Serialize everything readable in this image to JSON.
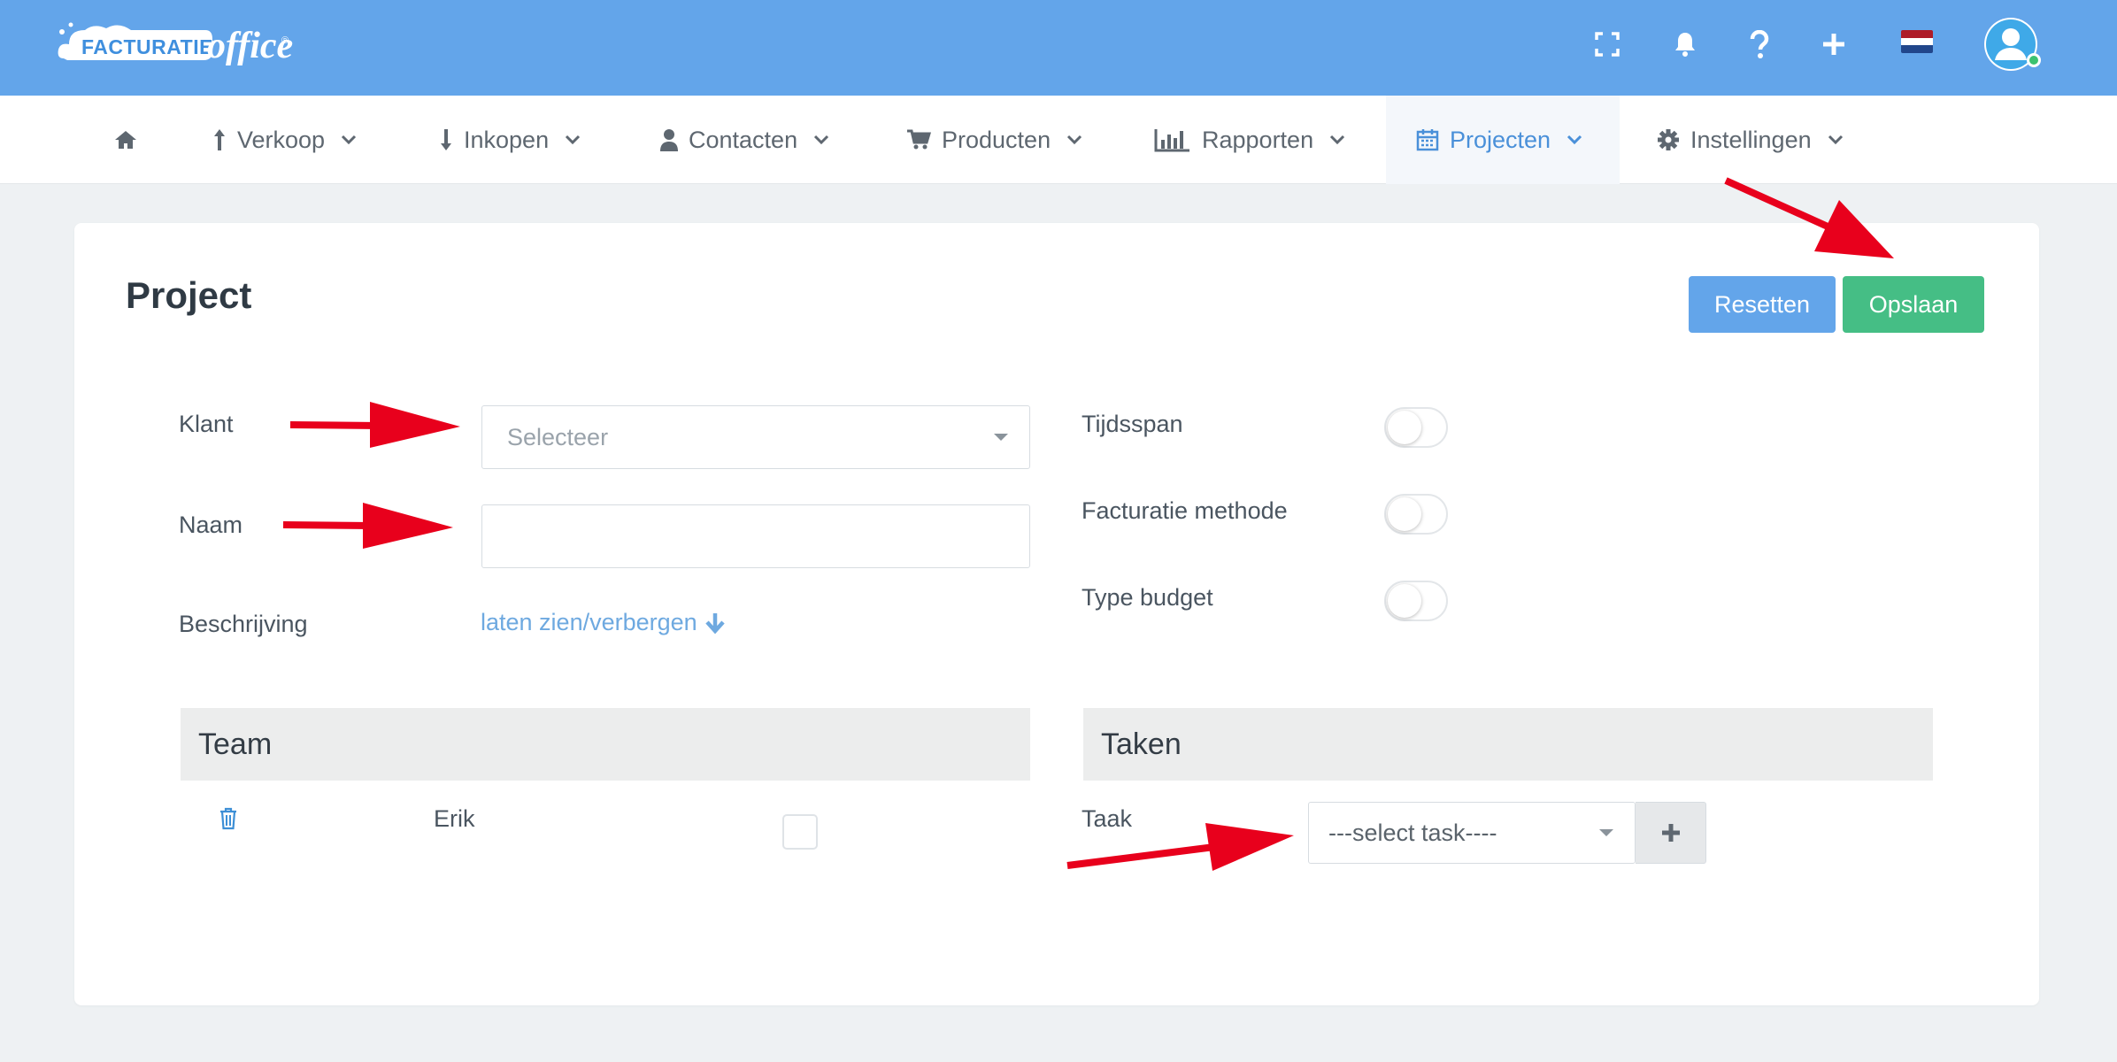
{
  "app": {
    "logo_text": "FACTURATIE",
    "logo_suffix": "office",
    "logo_reg": "®"
  },
  "topbar": {
    "icons": [
      "fullscreen-icon",
      "bell-icon",
      "question-icon",
      "plus-icon",
      "flag-nl-icon",
      "user-avatar-icon"
    ],
    "flag_colors": [
      "#ae1c28",
      "#ffffff",
      "#21468b"
    ],
    "brand_color": "#63a5ea"
  },
  "nav": {
    "items": [
      {
        "label": "",
        "icon": "home-icon"
      },
      {
        "label": "Verkoop",
        "icon": "arrow-up-icon"
      },
      {
        "label": "Inkopen",
        "icon": "arrow-down-icon"
      },
      {
        "label": "Contacten",
        "icon": "user-icon"
      },
      {
        "label": "Producten",
        "icon": "cart-icon"
      },
      {
        "label": "Rapporten",
        "icon": "bar-chart-icon"
      },
      {
        "label": "Projecten",
        "icon": "calendar-icon",
        "active": true
      },
      {
        "label": "Instellingen",
        "icon": "gear-icon"
      }
    ]
  },
  "page": {
    "title": "Project",
    "reset_label": "Resetten",
    "save_label": "Opslaan",
    "reset_color": "#63a5ea",
    "save_color": "#45be85"
  },
  "form": {
    "klant_label": "Klant",
    "klant_placeholder": "Selecteer",
    "naam_label": "Naam",
    "naam_value": "",
    "beschrijving_label": "Beschrijving",
    "beschrijving_link": "laten zien/verbergen",
    "tijdsspan_label": "Tijdsspan",
    "tijdsspan_on": false,
    "facturatie_label": "Facturatie methode",
    "facturatie_on": false,
    "budget_label": "Type budget",
    "budget_on": false
  },
  "team": {
    "heading": "Team",
    "members": [
      {
        "name": "Erik",
        "checked": false
      }
    ]
  },
  "taken": {
    "heading": "Taken",
    "taak_label": "Taak",
    "select_value": "---select task----"
  },
  "annotations": {
    "arrow_color": "#e8001c"
  }
}
